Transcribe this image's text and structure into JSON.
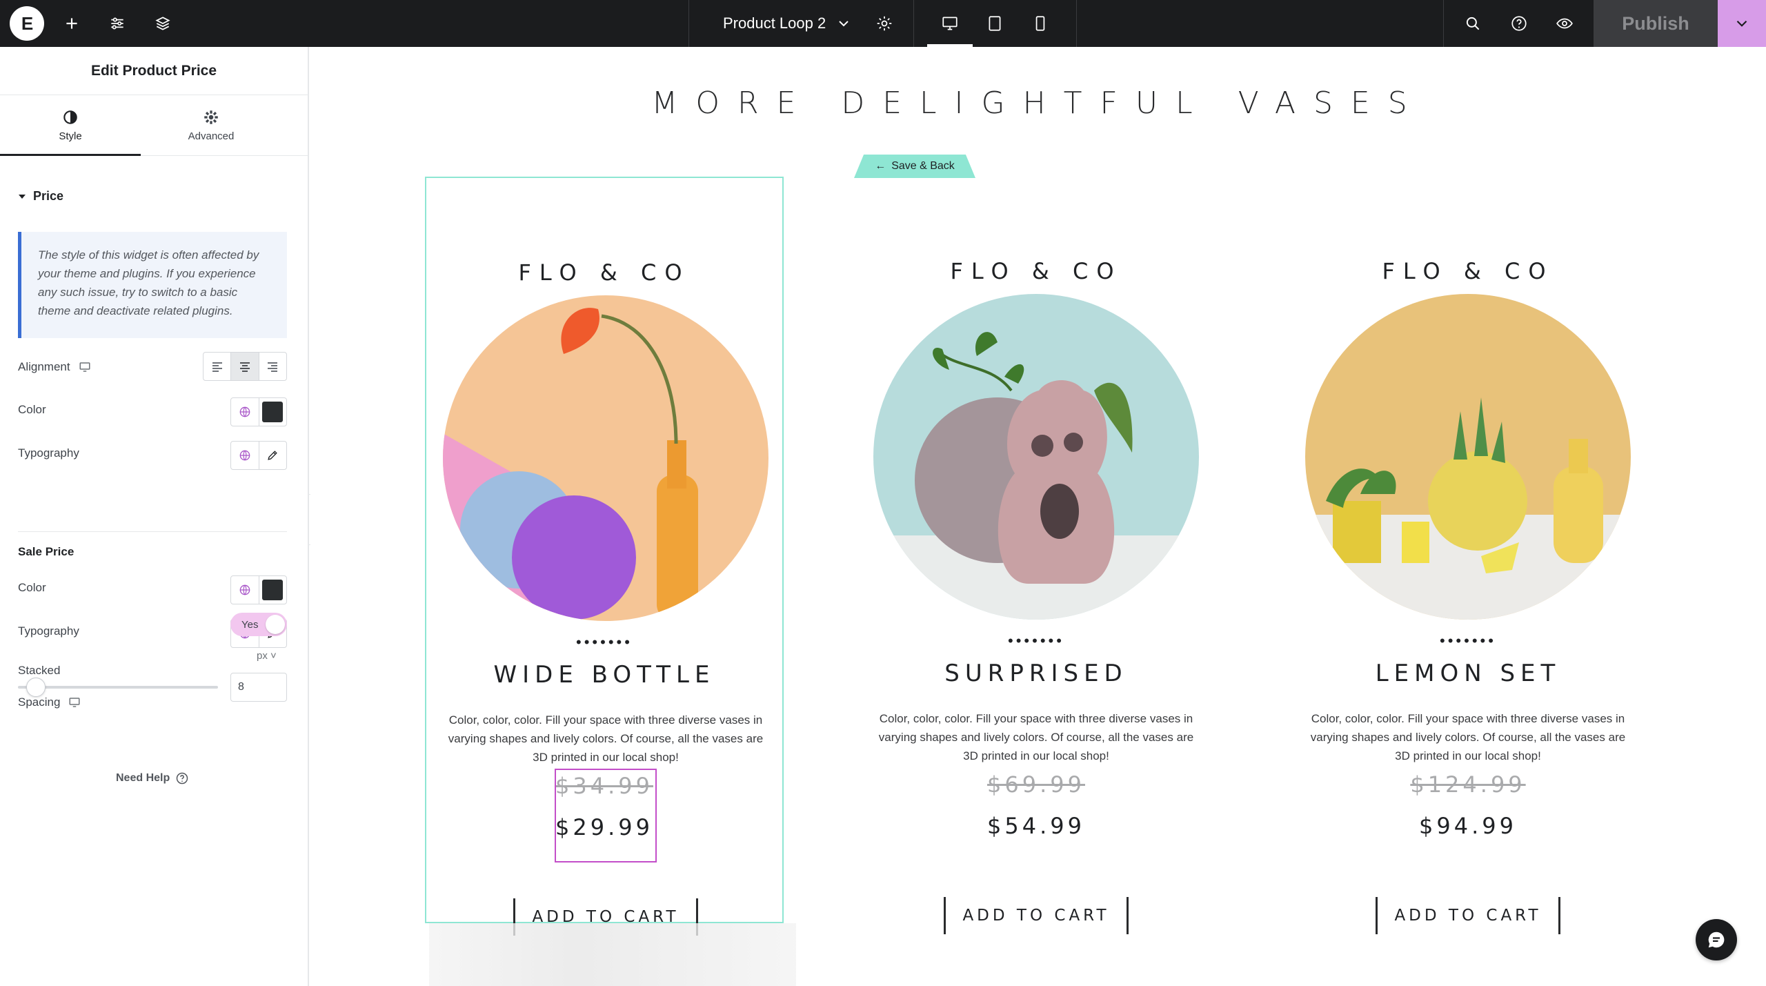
{
  "topbar": {
    "logo": "E",
    "doc_title": "Product Loop 2",
    "publish_label": "Publish",
    "icons": [
      "add-icon",
      "sliders-icon",
      "layers-icon",
      "chevron-down-icon",
      "gear-icon",
      "desktop-icon",
      "tablet-icon",
      "mobile-icon",
      "search-icon",
      "help-icon",
      "eye-icon",
      "chevron-down-icon"
    ],
    "accent": "#d79ce8"
  },
  "panel": {
    "title": "Edit Product Price",
    "tabs": [
      {
        "label": "Style"
      },
      {
        "label": "Advanced"
      }
    ],
    "section": "Price",
    "notice": "The style of this widget is often affected by your theme and plugins. If you experience any such issue, try to switch to a basic theme and deactivate related plugins.",
    "price": {
      "alignment_label": "Alignment",
      "color_label": "Color",
      "typography_label": "Typography"
    },
    "sale_price": {
      "heading": "Sale Price",
      "color_label": "Color",
      "typography_label": "Typography",
      "stacked_label": "Stacked",
      "stacked_value": "Yes",
      "spacing_label": "Spacing",
      "spacing_unit": "px ˅",
      "spacing_value": "8"
    },
    "need_help": "Need Help"
  },
  "canvas": {
    "heading": "MORE DELIGHTFUL VASES",
    "save_back": "Save & Back",
    "products": [
      {
        "brand": "FLO & CO",
        "dots": "•••••••",
        "name": "WIDE BOTTLE",
        "description": "Color, color, color. Fill your space with three diverse vases in varying shapes and lively colors. Of course, all the vases are 3D printed in our local shop!",
        "regular_price": "$34.99",
        "sale_price": "$29.99",
        "cta": "ADD TO CART"
      },
      {
        "brand": "FLO & CO",
        "dots": "•••••••",
        "name": "SURPRISED",
        "description": "Color, color, color. Fill your space with three diverse vases in varying shapes and lively colors. Of course, all the vases are 3D printed in our local shop!",
        "regular_price": "$69.99",
        "sale_price": "$54.99",
        "cta": "ADD TO CART"
      },
      {
        "brand": "FLO & CO",
        "dots": "•••••••",
        "name": "LEMON SET",
        "description": "Color, color, color. Fill your space with three diverse vases in varying shapes and lively colors. Of course, all the vases are 3D printed in our local shop!",
        "regular_price": "$124.99",
        "sale_price": "$94.99",
        "cta": "ADD TO CART"
      }
    ]
  }
}
